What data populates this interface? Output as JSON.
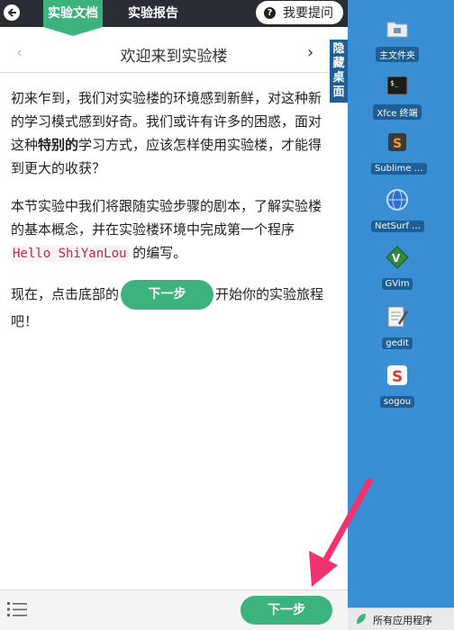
{
  "header": {
    "tabs": [
      {
        "label": "实验文档",
        "active": true
      },
      {
        "label": "实验报告",
        "active": false
      }
    ],
    "ask_button": {
      "label": "我要提问",
      "icon": "question-circle-icon"
    },
    "back_icon": "arrow-left-circle-icon"
  },
  "titlebar": {
    "title": "欢迎来到实验楼",
    "prev_icon": "chevron-left-icon",
    "next_icon": "chevron-right-icon"
  },
  "content": {
    "p1_a": "初来乍到，我们对实验楼的环境感到新鲜，对这种新的学习模式感到好奇。我们或许有许多的困惑，面对这种",
    "p1_bold": "特别的",
    "p1_b": "学习方式，应该怎样使用实验楼，才能得到更大的收获？",
    "p2_a": "本节实验中我们将跟随实验步骤的剧本，了解实验楼的基本概念，并在实验楼环境中完成第一个程序 ",
    "p2_code": "Hello ShiYanLou",
    "p2_b": " 的编写。",
    "p3_a": "现在，点击底部的",
    "p3_button": "下一步",
    "p3_b": "开始你的实验旅程吧！"
  },
  "bottom": {
    "menu_icon": "list-icon",
    "next_label": "下一步"
  },
  "desktop": {
    "hide_label": "隐藏桌面",
    "icons": [
      {
        "label": "主文件夹",
        "icon": "folder-icon"
      },
      {
        "label": "Xfce 终端",
        "icon": "terminal-icon"
      },
      {
        "label": "Sublime …",
        "icon": "sublime-icon"
      },
      {
        "label": "NetSurf …",
        "icon": "netsurf-icon"
      },
      {
        "label": "GVim",
        "icon": "gvim-icon"
      },
      {
        "label": "gedit",
        "icon": "gedit-icon"
      },
      {
        "label": "sogou",
        "icon": "sogou-icon"
      }
    ],
    "taskbar_label": "所有应用程序"
  },
  "colors": {
    "accent": "#3cb37d",
    "topbar": "#2a2d33",
    "desktop": "#3a8ed3",
    "arrow": "#f0336f"
  }
}
